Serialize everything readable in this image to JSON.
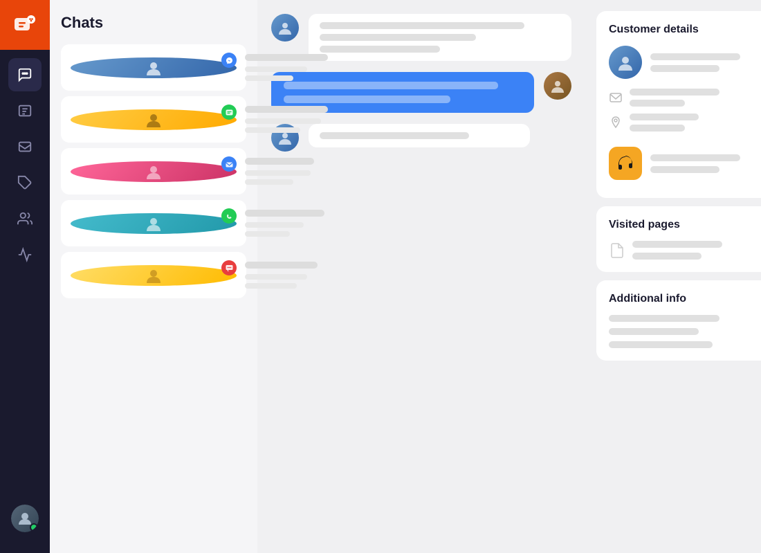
{
  "app": {
    "title": "Chats"
  },
  "sidebar": {
    "logo_icon": "chat-icon",
    "items": [
      {
        "id": "chats",
        "label": "Chats",
        "active": true
      },
      {
        "id": "tickets",
        "label": "Tickets",
        "active": false
      },
      {
        "id": "inbox",
        "label": "Inbox",
        "active": false
      },
      {
        "id": "coupons",
        "label": "Coupons",
        "active": false
      },
      {
        "id": "teams",
        "label": "Teams",
        "active": false
      },
      {
        "id": "reports",
        "label": "Reports",
        "active": false
      }
    ],
    "user_status": "online"
  },
  "chat_list": {
    "title": "Chats",
    "items": [
      {
        "id": 1,
        "badge_color": "#3b82f6",
        "badge_icon": "messenger"
      },
      {
        "id": 2,
        "badge_color": "#22cc55",
        "badge_icon": "message"
      },
      {
        "id": 3,
        "badge_color": "#3b82f6",
        "badge_icon": "email"
      },
      {
        "id": 4,
        "badge_color": "#22cc55",
        "badge_icon": "whatsapp"
      },
      {
        "id": 5,
        "badge_color": "#e83e3e",
        "badge_icon": "sms"
      }
    ]
  },
  "conversation": {
    "messages": [
      {
        "id": 1,
        "type": "incoming",
        "lines": 3
      },
      {
        "id": 2,
        "type": "outgoing_blue",
        "lines": 2
      },
      {
        "id": 3,
        "type": "incoming_small",
        "lines": 1
      }
    ]
  },
  "customer_details": {
    "section_title": "Customer details",
    "visited_pages_title": "Visited pages",
    "additional_info_title": "Additional info",
    "app_name": "Headphones App"
  }
}
